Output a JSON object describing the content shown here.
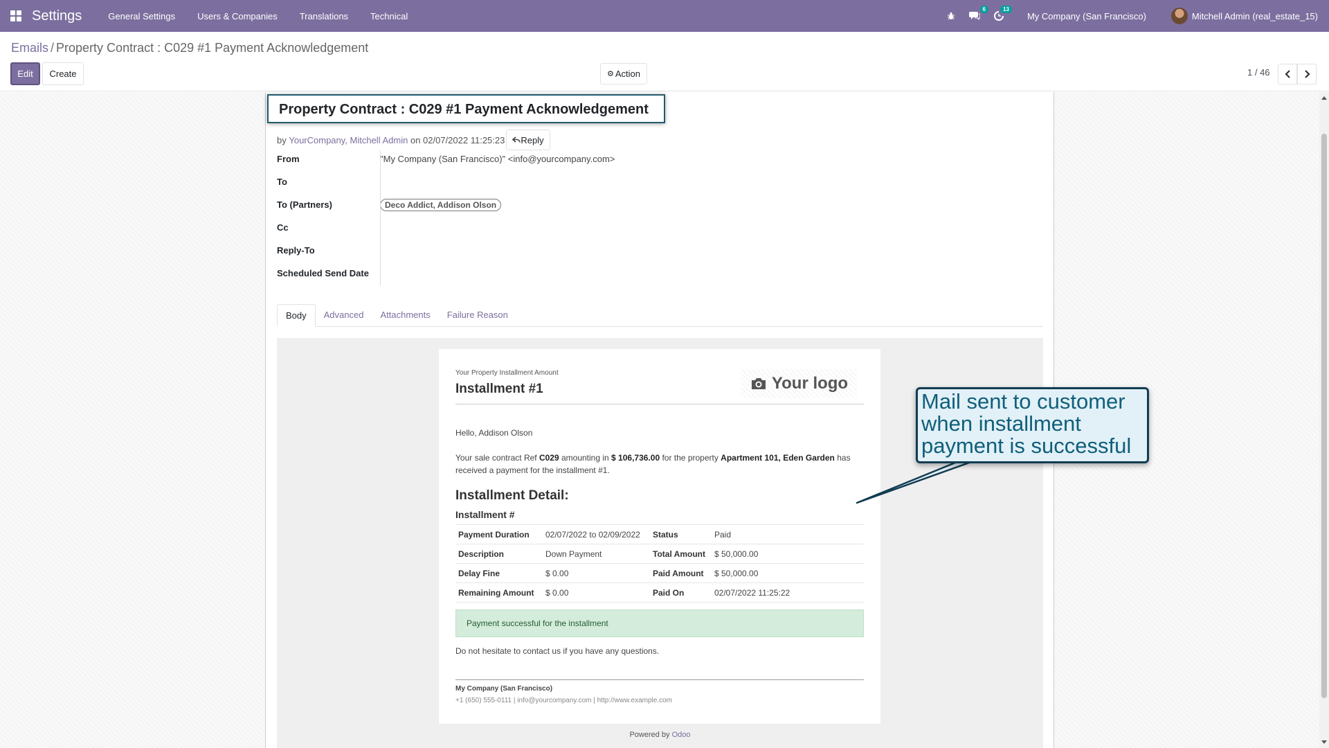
{
  "navbar": {
    "app_name": "Settings",
    "menu": [
      "General Settings",
      "Users & Companies",
      "Translations",
      "Technical"
    ],
    "messages_badge": "6",
    "activities_badge": "13",
    "company": "My Company (San Francisco)",
    "user": "Mitchell Admin (real_estate_15)",
    "color": "#7c6f9f"
  },
  "breadcrumb": {
    "parent": "Emails",
    "separator": "/",
    "current": "Property Contract : C029 #1 Payment Acknowledgement"
  },
  "toolbar": {
    "edit_label": "Edit",
    "create_label": "Create",
    "action_label": "Action"
  },
  "pager": {
    "value": "1 / 46"
  },
  "record": {
    "subject": "Property Contract : C029 #1 Payment Acknowledgement",
    "by_prefix": "by",
    "author": "YourCompany, Mitchell Admin",
    "on_text": "on 02/07/2022 11:25:23",
    "reply_label": "Reply",
    "fields": {
      "from_label": "From",
      "from_value": "\"My Company (San Francisco)\" <info@yourcompany.com>",
      "to_label": "To",
      "to_partners_label": "To (Partners)",
      "to_partners_tag": "Deco Addict, Addison Olson",
      "cc_label": "Cc",
      "reply_to_label": "Reply-To",
      "scheduled_label": "Scheduled Send Date"
    },
    "tabs": [
      "Body",
      "Advanced",
      "Attachments",
      "Failure Reason"
    ]
  },
  "email_body": {
    "small_heading": "Your Property Installment Amount",
    "title": "Installment #1",
    "logo_text": "Your logo",
    "greeting": "Hello, Addison Olson",
    "para": {
      "t1": "Your sale contract Ref ",
      "ref": "C029",
      "t2": " amounting in ",
      "amount": "$ 106,736.00",
      "t3": " for the property ",
      "property": "Apartment 101, Eden Garden",
      "t4": " has received a payment for the installment #1."
    },
    "detail_heading": "Installment Detail:",
    "installment_sub": "Installment #",
    "table": [
      [
        "Payment Duration",
        "02/07/2022 to 02/09/2022",
        "Status",
        "Paid"
      ],
      [
        "Description",
        "Down Payment",
        "Total Amount",
        "$ 50,000.00"
      ],
      [
        "Delay Fine",
        "$ 0.00",
        "Paid Amount",
        "$ 50,000.00"
      ],
      [
        "Remaining Amount",
        "$ 0.00",
        "Paid On",
        "02/07/2022 11:25:22"
      ]
    ],
    "alert": "Payment successful for the installment",
    "contact": "Do not hesitate to contact us if you have any questions.",
    "company": "My Company (San Francisco)",
    "footer": "+1 (650) 555-0111 | info@yourcompany.com | http://www.example.com",
    "powered_by": "Powered by",
    "powered_brand": "Odoo"
  },
  "callout": {
    "lines": [
      "Mail sent to customer",
      "when installment",
      "payment is successful"
    ]
  }
}
